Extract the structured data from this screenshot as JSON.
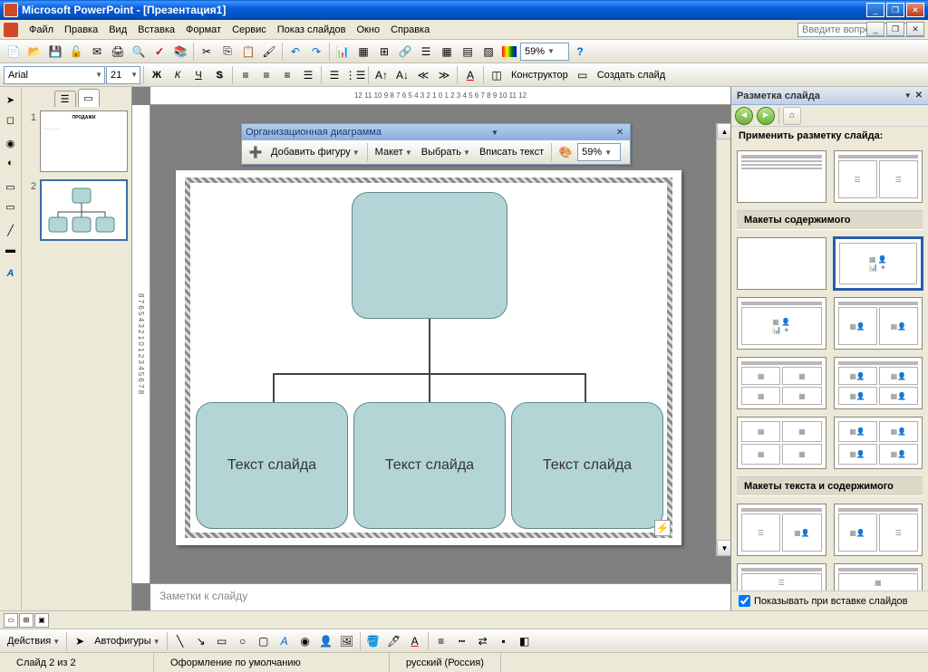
{
  "title": "Microsoft PowerPoint - [Презентация1]",
  "menu": [
    "Файл",
    "Правка",
    "Вид",
    "Вставка",
    "Формат",
    "Сервис",
    "Показ слайдов",
    "Окно",
    "Справка"
  ],
  "ask_placeholder": "Введите вопрос",
  "font": {
    "name": "Arial",
    "size": "21"
  },
  "zoom": "59%",
  "toolbar2": {
    "constructor": "Конструктор",
    "newslide": "Создать слайд"
  },
  "org": {
    "title": "Организационная диаграмма",
    "add": "Добавить фигуру",
    "layout": "Макет",
    "select": "Выбрать",
    "fit": "Вписать текст",
    "zoom": "59%"
  },
  "slide": {
    "text": "Текст слайда"
  },
  "notes": "Заметки к слайду",
  "taskpane": {
    "title": "Разметка слайда",
    "apply": "Применить разметку слайда:",
    "sec_content": "Макеты содержимого",
    "sec_text_content": "Макеты текста и содержимого",
    "show_on_insert": "Показывать при вставке слайдов"
  },
  "thumbs": [
    {
      "num": "1",
      "title": "ПРОДАЖИ"
    },
    {
      "num": "2"
    }
  ],
  "drawbar": {
    "actions": "Действия",
    "autoshapes": "Автофигуры"
  },
  "status": {
    "slide": "Слайд 2 из 2",
    "design": "Оформление по умолчанию",
    "lang": "русский (Россия)"
  },
  "ruler": "12  11  10  9  8  7  6  5  4  3  2  1  0  1  2  3  4  5  6  7  8  9  10  11  12",
  "vruler": "8 7 6 5 4 3 2 1 0 1 2 3 4 5 6 7 8"
}
